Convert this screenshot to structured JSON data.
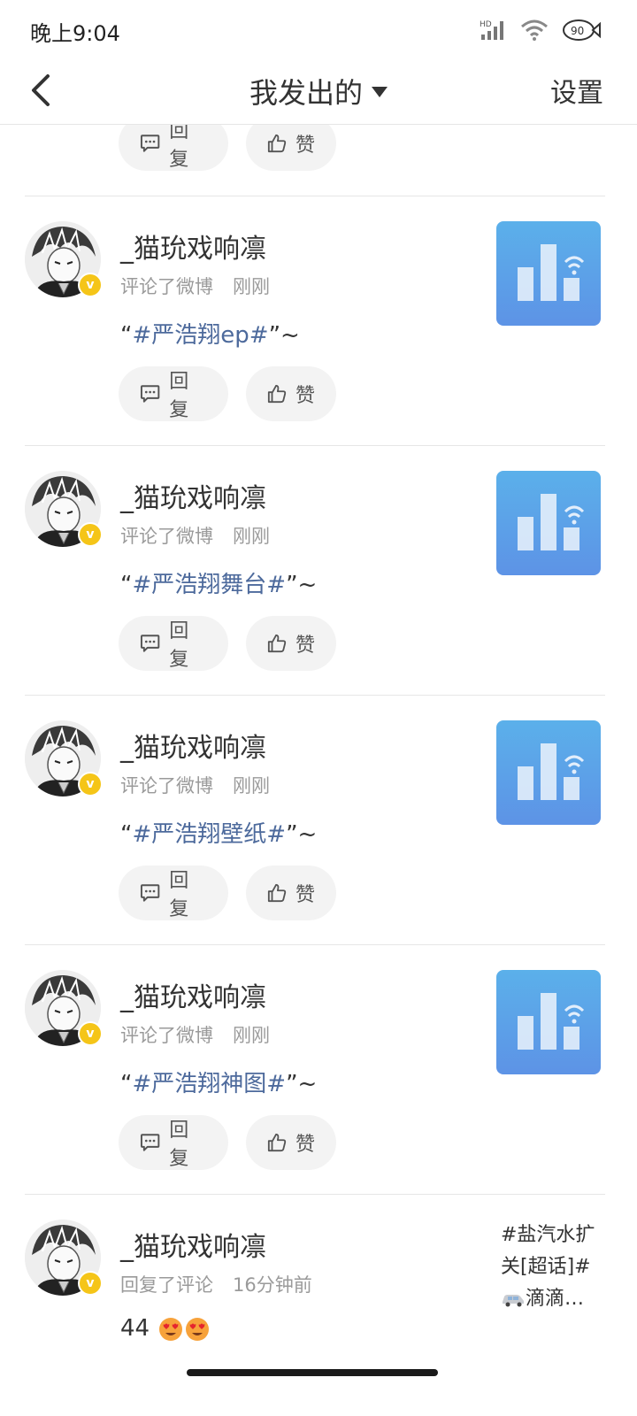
{
  "status_bar": {
    "time": "晚上9:04",
    "hd_label": "HD",
    "battery": "90"
  },
  "header": {
    "title": "我发出的",
    "settings": "设置"
  },
  "actions": {
    "reply": "回复",
    "like": "赞"
  },
  "items": [
    {
      "username": "_猫玧戏响凛",
      "action": "评论了微博",
      "time": "刚刚",
      "quote_open": "“",
      "topic": "#严浩翔ep#",
      "quote_close": "”~"
    },
    {
      "username": "_猫玧戏响凛",
      "action": "评论了微博",
      "time": "刚刚",
      "quote_open": "“",
      "topic": "#严浩翔舞台#",
      "quote_close": "”~"
    },
    {
      "username": "_猫玧戏响凛",
      "action": "评论了微博",
      "time": "刚刚",
      "quote_open": "“",
      "topic": "#严浩翔壁纸#",
      "quote_close": "”~"
    },
    {
      "username": "_猫玧戏响凛",
      "action": "评论了微博",
      "time": "刚刚",
      "quote_open": "“",
      "topic": "#严浩翔神图#",
      "quote_close": "”~"
    },
    {
      "username": "_猫玧戏响凛",
      "action": "回复了评论",
      "time": "16分钟前",
      "text": "44",
      "side_line1": "#盐汽水扩",
      "side_line2": "关[超话]#",
      "side_line3": "滴滴…"
    }
  ],
  "icons": {
    "back": "back-arrow-icon",
    "dropdown": "caret-down-icon",
    "reply": "comment-icon",
    "like": "thumbs-up-icon",
    "verified": "verified-badge-icon",
    "thumbnail": "weibo-stats-icon",
    "car": "car-emoji",
    "emoji": "heart-eyes-emoji"
  },
  "colors": {
    "topic": "#4d6a9c",
    "badge": "#f5c518",
    "thumb_top": "#5bb0ea",
    "thumb_bottom": "#5d93e6"
  }
}
